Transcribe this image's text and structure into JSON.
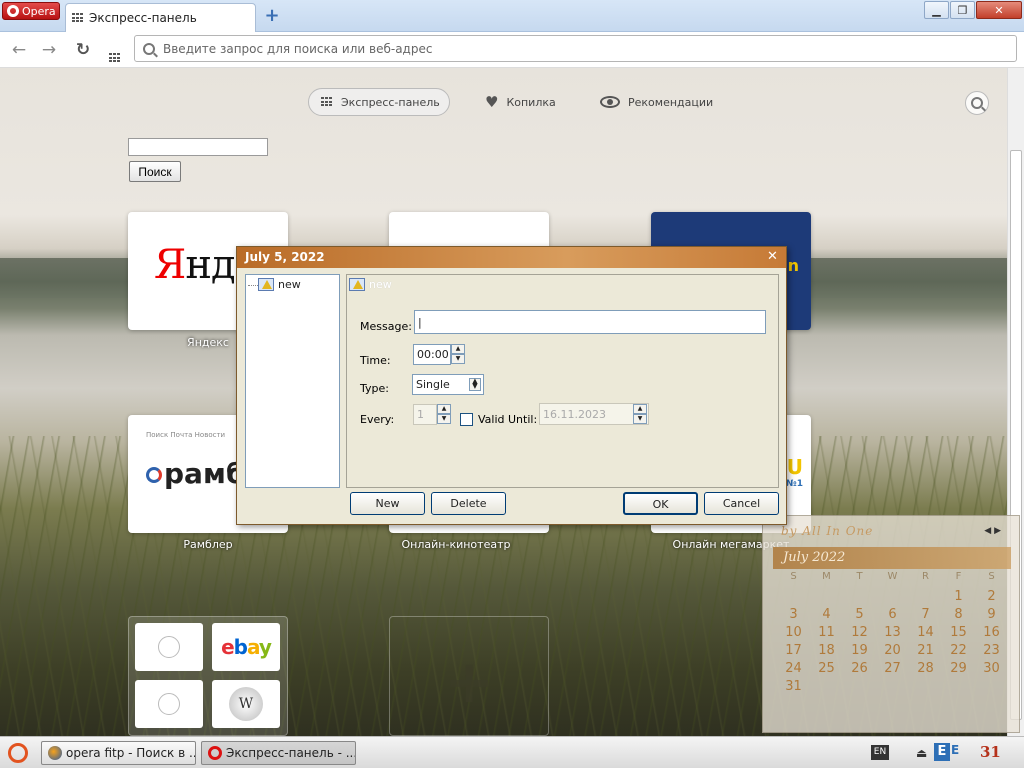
{
  "browser": {
    "menu_label": "Opera",
    "tab_title": "Экспресс-панель",
    "new_tab": "+",
    "window_controls": {
      "minimize": "▁",
      "maximize": "❐",
      "close": "✕"
    },
    "nav": {
      "back": "←",
      "forward": "→",
      "reload": "↻"
    },
    "address_placeholder": "Введите запрос для поиска или веб-адрес"
  },
  "speed_dial": {
    "nav": [
      {
        "label": "Экспресс-панель",
        "icon": "grid-icon",
        "active": true
      },
      {
        "label": "Копилка",
        "icon": "heart-icon",
        "active": false
      },
      {
        "label": "Рекомендации",
        "icon": "eye-icon",
        "active": false
      }
    ],
    "search_button_label": "Поиск",
    "tiles": [
      {
        "label": "Яндекс",
        "logo_text_red": "Я",
        "logo_text_black": "ндекс"
      },
      {
        "label": "Онлайн-кинотеатр"
      },
      {
        "label": "Онлайн мегамаркет",
        "logo_text": "n"
      },
      {
        "label": "Рамблер",
        "logo_text": "рамбл",
        "top_links": "Поиск   Почта   Новости"
      }
    ],
    "mini_tiles": {
      "ebay_text": "ebay",
      "wiki_text": "W"
    },
    "add_tile_symbol": "+"
  },
  "calendar": {
    "header": "by All In One",
    "arrows": "◀ ▶",
    "month": "July 2022",
    "weekdays": [
      "S",
      "M",
      "T",
      "W",
      "R",
      "F",
      "S"
    ],
    "days": [
      "",
      "",
      "",
      "",
      "",
      "1",
      "2",
      "3",
      "4",
      "5",
      "6",
      "7",
      "8",
      "9",
      "10",
      "11",
      "12",
      "13",
      "14",
      "15",
      "16",
      "17",
      "18",
      "19",
      "20",
      "21",
      "22",
      "23",
      "24",
      "25",
      "26",
      "27",
      "28",
      "29",
      "30",
      "31"
    ],
    "colors": {
      "month_bar": "#b98046",
      "day_text": "#b07a3b"
    }
  },
  "dialog": {
    "title": "July 5, 2022",
    "close": "✕",
    "tree_item": "new",
    "detail_header": "new",
    "labels": {
      "message": "Message:",
      "time": "Time:",
      "type": "Type:",
      "every": "Every:",
      "valid_until": "Valid Until:"
    },
    "values": {
      "message": "|",
      "time": "00:00",
      "type": "Single",
      "every": "1",
      "valid_until": "16.11.2023"
    },
    "buttons": {
      "new": "New",
      "delete": "Delete",
      "ok": "OK",
      "cancel": "Cancel"
    }
  },
  "taskbar": {
    "tasks": [
      {
        "label": "opera fitp - Поиск в ...",
        "icon": "firefox-icon",
        "active": false
      },
      {
        "label": "Экспресс-панель - ...",
        "icon": "opera-icon",
        "active": true
      }
    ],
    "tray": {
      "keyboard": "EN",
      "eject": "⏏",
      "e_icon": "E",
      "sheet_icon": "E",
      "calendar_icon": "31"
    }
  }
}
